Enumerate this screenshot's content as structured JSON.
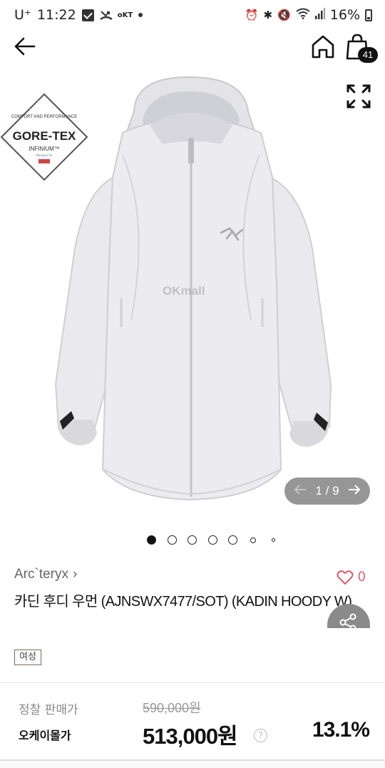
{
  "status_bar": {
    "carrier": "U⁺",
    "time": "11:22",
    "notif_text": "oKT",
    "battery": "16%"
  },
  "header": {
    "cart_count": "41"
  },
  "gallery": {
    "badge_top": "COMFORT AND PERFORMANCE",
    "badge_brand": "GORE-TEX",
    "badge_sub": "INFINIUM™",
    "badge_small": "PRODUCTS",
    "watermark": "OKmall",
    "counter_current": "1",
    "counter_total": "9",
    "pages": 9
  },
  "product": {
    "brand": "Arc`teryx",
    "wish_count": "0",
    "title": "카딘 후디 우먼 (AJNSWX7477/SOT) (KADIN HOODY W)",
    "tag": "여성"
  },
  "price": {
    "list_label": "정찰 판매가",
    "list_price": "590,000원",
    "ok_label": "오케이몰가",
    "ok_price": "513,000원",
    "help": "?",
    "discount": "13.1%"
  },
  "colors": {
    "accent_heart": "#e05a6e",
    "jacket": "#ebebef",
    "counter_bg": "#6e6e6e"
  }
}
